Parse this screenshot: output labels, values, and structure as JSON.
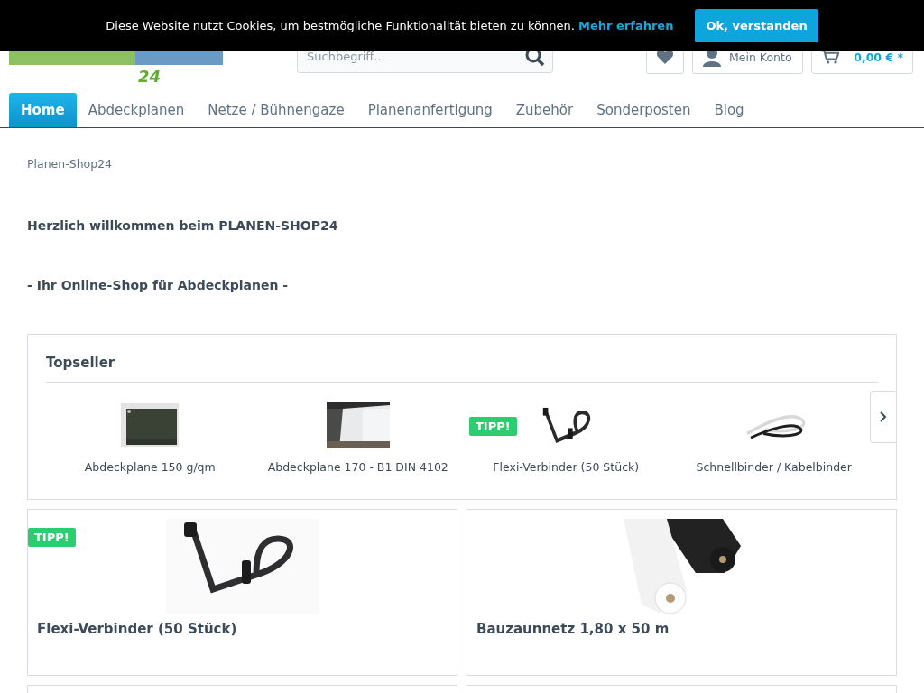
{
  "cookie_banner": {
    "text": "Diese Website nutzt Cookies, um bestmögliche Funktionalität bieten zu können.",
    "link": "Mehr erfahren",
    "button": "Ok, verstanden"
  },
  "header": {
    "logo_number": "24",
    "search": {
      "placeholder": "Suchbegriff..."
    },
    "account": "Mein Konto",
    "cart": "0,00 € *"
  },
  "nav": [
    {
      "label": "Home",
      "selected": true
    },
    {
      "label": "Abdeckplanen",
      "selected": false
    },
    {
      "label": "Netze / Bühnengaze",
      "selected": false
    },
    {
      "label": "Planenanfertigung",
      "selected": false
    },
    {
      "label": "Zubehör",
      "selected": false
    },
    {
      "label": "Sonderposten",
      "selected": false
    },
    {
      "label": "Blog",
      "selected": false
    }
  ],
  "breadcrumb": "Planen-Shop24",
  "welcome": {
    "heading": "Herzlich willkommen beim PLANEN-SHOP24",
    "subheading": "- Ihr Online-Shop für Abdeckplanen -"
  },
  "topseller": {
    "title": "Topseller",
    "items": [
      {
        "name": "Abdeckplane 150 g/qm"
      },
      {
        "name": "Abdeckplane 170 - B1 DIN 4102"
      },
      {
        "name": "Flexi-Verbinder (50 Stück)",
        "badge": "TIPP!"
      },
      {
        "name": "Schnellbinder / Kabelbinder"
      }
    ]
  },
  "products": [
    {
      "name": "Flexi-Verbinder (50 Stück)",
      "badge": "TIPP!"
    },
    {
      "name": "Bauzaunnetz 1,80 x 50 m"
    }
  ]
}
